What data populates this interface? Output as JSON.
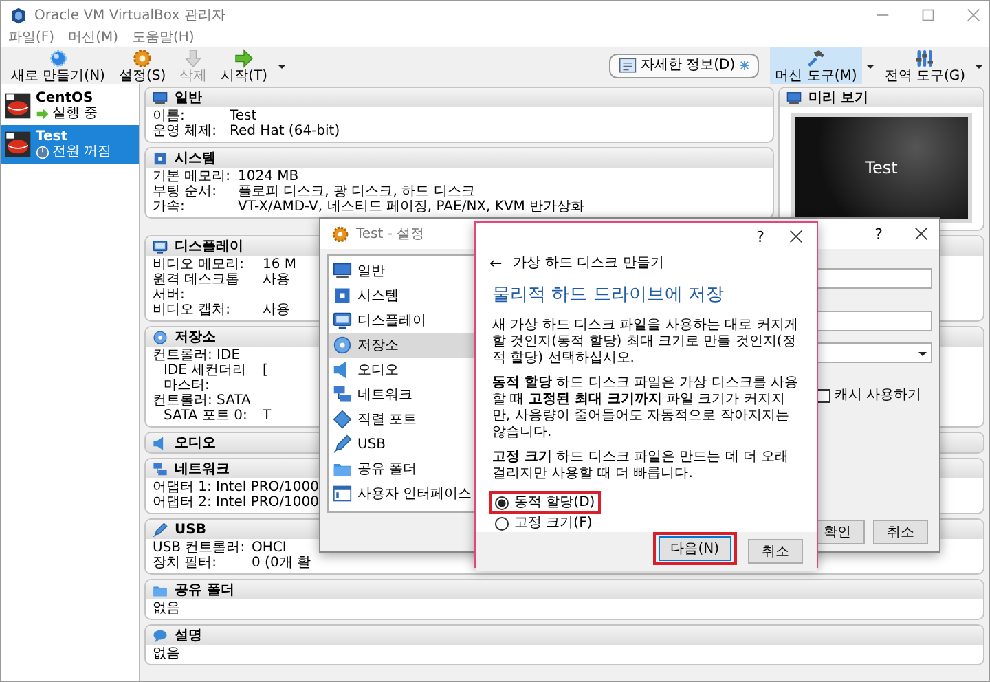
{
  "window": {
    "title": "Oracle VM VirtualBox 관리자"
  },
  "menu": [
    "파일(F)",
    "머신(M)",
    "도움말(H)"
  ],
  "toolbar": [
    {
      "label": "새로 만들기(N)",
      "kind": "new",
      "disabled": false
    },
    {
      "label": "설정(S)",
      "kind": "settings",
      "disabled": false
    },
    {
      "label": "삭제",
      "kind": "delete",
      "disabled": true
    },
    {
      "label": "시작(T)",
      "kind": "start",
      "disabled": false
    }
  ],
  "details_button": "자세한 정보(D)",
  "tool_buttons": [
    {
      "label": "머신 도구(M)",
      "kind": "machine",
      "selected": true
    },
    {
      "label": "전역 도구(G)",
      "kind": "global",
      "selected": false
    }
  ],
  "vms": [
    {
      "name": "CentOS",
      "state": "실행 중",
      "kind": "running",
      "selected": false
    },
    {
      "name": "Test",
      "state": "전원 꺼짐",
      "kind": "off",
      "selected": true
    }
  ],
  "details_top": [
    {
      "title": "일반",
      "kind": "general",
      "rows": [
        {
          "kind": "pair",
          "label": "이름:",
          "value": "Test"
        },
        {
          "kind": "pair",
          "label": "운영 체제:",
          "value": "Red Hat (64-bit)"
        }
      ]
    },
    {
      "title": "시스템",
      "kind": "system",
      "rows": [
        {
          "kind": "pair",
          "label": "기본 메모리:",
          "value": "1024 MB"
        },
        {
          "kind": "pair",
          "label": "부팅 순서:",
          "value": "플로피 디스크, 광 디스크, 하드 디스크"
        },
        {
          "kind": "pair",
          "label": "가속:",
          "value": "VT-X/AMD-V, 네스티드 페이징, PAE/NX, KVM 반가상화"
        }
      ]
    }
  ],
  "preview": {
    "title": "미리 보기",
    "screen_text": "Test"
  },
  "details": [
    {
      "title": "디스플레이",
      "kind": "display",
      "rows": [
        {
          "kind": "pair",
          "label": "비디오 메모리:",
          "value": "16 M"
        },
        {
          "kind": "pair",
          "label": "원격 데스크톱 서버:",
          "value": "사용"
        },
        {
          "kind": "pair",
          "label": "비디오 캡처:",
          "value": "사용"
        }
      ]
    },
    {
      "title": "저장소",
      "kind": "storage",
      "rows": [
        {
          "kind": "line",
          "text": "컨트롤러: IDE"
        },
        {
          "kind": "sub",
          "label": "IDE 세컨더리 마스터:",
          "value": "["
        },
        {
          "kind": "line",
          "text": "컨트롤러: SATA"
        },
        {
          "kind": "sub",
          "label": "SATA 포트 0:",
          "value": "T"
        }
      ]
    },
    {
      "title": "오디오",
      "kind": "audio"
    },
    {
      "title": "네트워크",
      "kind": "network",
      "rows": [
        {
          "kind": "pair",
          "label": "어댑터 1:",
          "value": "Intel PRO/1000"
        },
        {
          "kind": "pair",
          "label": "어댑터 2:",
          "value": "Intel PRO/1000"
        }
      ]
    },
    {
      "title": "USB",
      "kind": "usb",
      "rows": [
        {
          "kind": "pair",
          "label": "USB 컨트롤러:",
          "value": "OHCI"
        },
        {
          "kind": "pair",
          "label": "장치 필터:",
          "value": "0 (0개 활"
        }
      ]
    },
    {
      "title": "공유 폴더",
      "kind": "shared",
      "rows": [
        {
          "kind": "line",
          "text": "없음"
        }
      ]
    },
    {
      "title": "설명",
      "kind": "description",
      "rows": [
        {
          "kind": "line",
          "text": "없음"
        }
      ]
    }
  ],
  "settings_dialog": {
    "title": "Test - 설정",
    "help": "?",
    "categories": [
      {
        "label": "일반",
        "kind": "general",
        "selected": false
      },
      {
        "label": "시스템",
        "kind": "system",
        "selected": false
      },
      {
        "label": "디스플레이",
        "kind": "display",
        "selected": false
      },
      {
        "label": "저장소",
        "kind": "storage",
        "selected": true
      },
      {
        "label": "오디오",
        "kind": "audio",
        "selected": false
      },
      {
        "label": "네트워크",
        "kind": "network",
        "selected": false
      },
      {
        "label": "직렬 포트",
        "kind": "serial",
        "selected": false
      },
      {
        "label": "USB",
        "kind": "usb",
        "selected": false
      },
      {
        "label": "공유 폴더",
        "kind": "shared",
        "selected": false
      },
      {
        "label": "사용자 인터페이스",
        "kind": "ui",
        "selected": false
      }
    ],
    "cache_checkbox": {
      "label": "캐시 사용하기",
      "checked": false
    },
    "buttons": [
      "확인",
      "취소"
    ]
  },
  "wizard": {
    "help": "?",
    "back": "←",
    "title": "가상 하드 디스크 만들기",
    "heading": "물리적 하드 드라이브에 저장",
    "paragraphs": [
      "새 가상 하드 디스크 파일을 사용하는 대로 커지게 할 것인지(동적 할당) 최대 크기로 만들 것인지(정적 할당) 선택하십시오.",
      "**동적 할당** 하드 디스크 파일은 가상 디스크를 사용할 때 **고정된 최대 크기까지** 파일 크기가 커지지만, 사용량이 줄어들어도 자동적으로 작아지지는 않습니다.",
      "**고정 크기** 하드 디스크 파일은 만드는 데 더 오래 걸리지만 사용할 때 더 빠릅니다."
    ],
    "options": [
      {
        "label": "동적 할당(D)",
        "selected": true,
        "highlighted": true
      },
      {
        "label": "고정 크기(F)",
        "selected": false,
        "highlighted": false
      }
    ],
    "buttons": [
      {
        "label": "다음(N)",
        "highlighted": true
      },
      {
        "label": "취소",
        "highlighted": false
      }
    ]
  }
}
